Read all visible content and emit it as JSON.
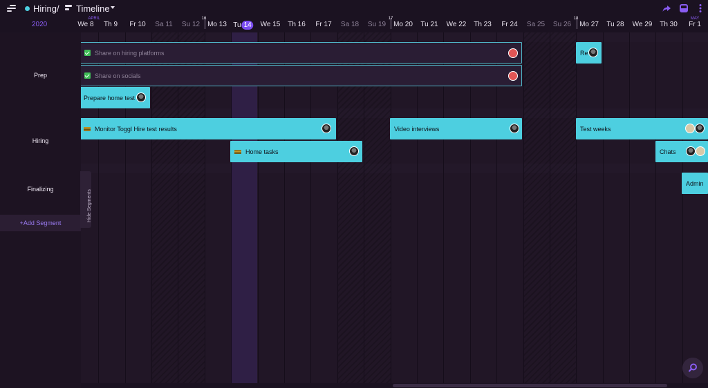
{
  "header": {
    "project_name": "Hiring",
    "separator": "/",
    "view_name": "Timeline",
    "project_color": "#4dcfe0",
    "accent_color": "#8a5cf2",
    "icons": [
      "menu-icon",
      "timeline-icon",
      "chevron-down-icon",
      "share-icon",
      "inbox-icon",
      "more-icon"
    ]
  },
  "date_header": {
    "year": "2020",
    "month_labels": [
      "APRIL",
      "MAY"
    ],
    "week_numbers": [
      "16",
      "17",
      "18"
    ],
    "days": [
      {
        "label": "We 8",
        "weekend": false
      },
      {
        "label": "Th 9",
        "weekend": false
      },
      {
        "label": "Fr 10",
        "weekend": false
      },
      {
        "label": "Sa 11",
        "weekend": true
      },
      {
        "label": "Su 12",
        "weekend": true
      },
      {
        "label": "Mo 13",
        "weekend": false
      },
      {
        "label": "Tu",
        "badge": "14",
        "weekend": false,
        "today": true
      },
      {
        "label": "We 15",
        "weekend": false
      },
      {
        "label": "Th 16",
        "weekend": false
      },
      {
        "label": "Fr 17",
        "weekend": false
      },
      {
        "label": "Sa 18",
        "weekend": true
      },
      {
        "label": "Su 19",
        "weekend": true
      },
      {
        "label": "Mo 20",
        "weekend": false
      },
      {
        "label": "Tu 21",
        "weekend": false
      },
      {
        "label": "We 22",
        "weekend": false
      },
      {
        "label": "Th 23",
        "weekend": false
      },
      {
        "label": "Fr 24",
        "weekend": false
      },
      {
        "label": "Sa 25",
        "weekend": true
      },
      {
        "label": "Su 26",
        "weekend": true
      },
      {
        "label": "Mo 27",
        "weekend": false
      },
      {
        "label": "Tu 28",
        "weekend": false
      },
      {
        "label": "We 29",
        "weekend": false
      },
      {
        "label": "Th 30",
        "weekend": false
      },
      {
        "label": "Fr 1",
        "weekend": false
      }
    ]
  },
  "segments": [
    {
      "name": "Prep"
    },
    {
      "name": "Hiring"
    },
    {
      "name": "Finalizing"
    }
  ],
  "add_segment_label": "+Add Segment",
  "hide_segments_label": "Hide Segments",
  "tasks": {
    "share_hiring": {
      "label": "Share on hiring platforms",
      "completed": true
    },
    "re": {
      "label": "Re",
      "completed": false
    },
    "share_socials": {
      "label": "Share on socials",
      "completed": true
    },
    "prepare_test": {
      "label": "Prepare home test",
      "completed": false
    },
    "monitor": {
      "label": "Monitor Toggl Hire test results",
      "completed": false
    },
    "video": {
      "label": "Video interviews",
      "completed": false
    },
    "test_weeks": {
      "label": "Test weeks",
      "completed": false
    },
    "home_tasks": {
      "label": "Home tasks",
      "completed": false
    },
    "chats": {
      "label": "Chats",
      "completed": false
    },
    "admin": {
      "label": "Admin",
      "completed": false
    }
  },
  "zoom_icon": "zoom-icon"
}
